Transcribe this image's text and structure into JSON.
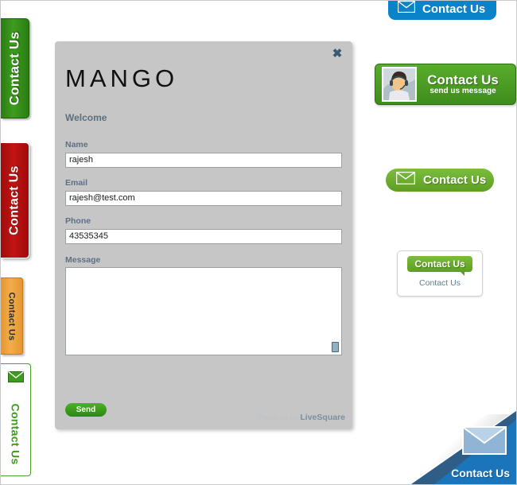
{
  "modal": {
    "brand": "MANGO",
    "welcome": "Welcome",
    "close_icon": "close-icon",
    "fields": [
      {
        "label": "Name",
        "value": "rajesh",
        "placeholder": ""
      },
      {
        "label": "Email",
        "value": "rajesh@test.com",
        "placeholder": ""
      },
      {
        "label": "Phone",
        "value": "43535345",
        "placeholder": ""
      },
      {
        "label": "Message",
        "value": "",
        "placeholder": ""
      }
    ],
    "send_label": "Send",
    "powered_prefix": "Powered by ",
    "powered_brand": "LiveSquare"
  },
  "side_tabs": [
    {
      "label": "Contact Us",
      "color": "#2e8b14"
    },
    {
      "label": "Contact Us",
      "color": "#b00d0d"
    },
    {
      "label": "Contact Us",
      "color": "#eda23c"
    },
    {
      "label": "Contact Us",
      "color": "#3d9c1e",
      "icon": "envelope-icon"
    }
  ],
  "widgets": {
    "blue_pill": {
      "label": "Contact Us",
      "icon": "envelope-icon",
      "color": "#0b83c9"
    },
    "green_banner": {
      "title": "Contact Us",
      "subtitle": "send us message",
      "thumb": "support-agent-photo",
      "color": "#4a9e23"
    },
    "green_pill": {
      "label": "Contact Us",
      "icon": "envelope-icon",
      "color": "#6aad2e"
    },
    "card": {
      "button_label": "Contact Us",
      "link_label": "Contact Us",
      "color": "#6aad2e"
    },
    "corner_curl": {
      "label": "Contact Us",
      "icon": "envelope-icon",
      "color": "#1b75bb"
    }
  }
}
